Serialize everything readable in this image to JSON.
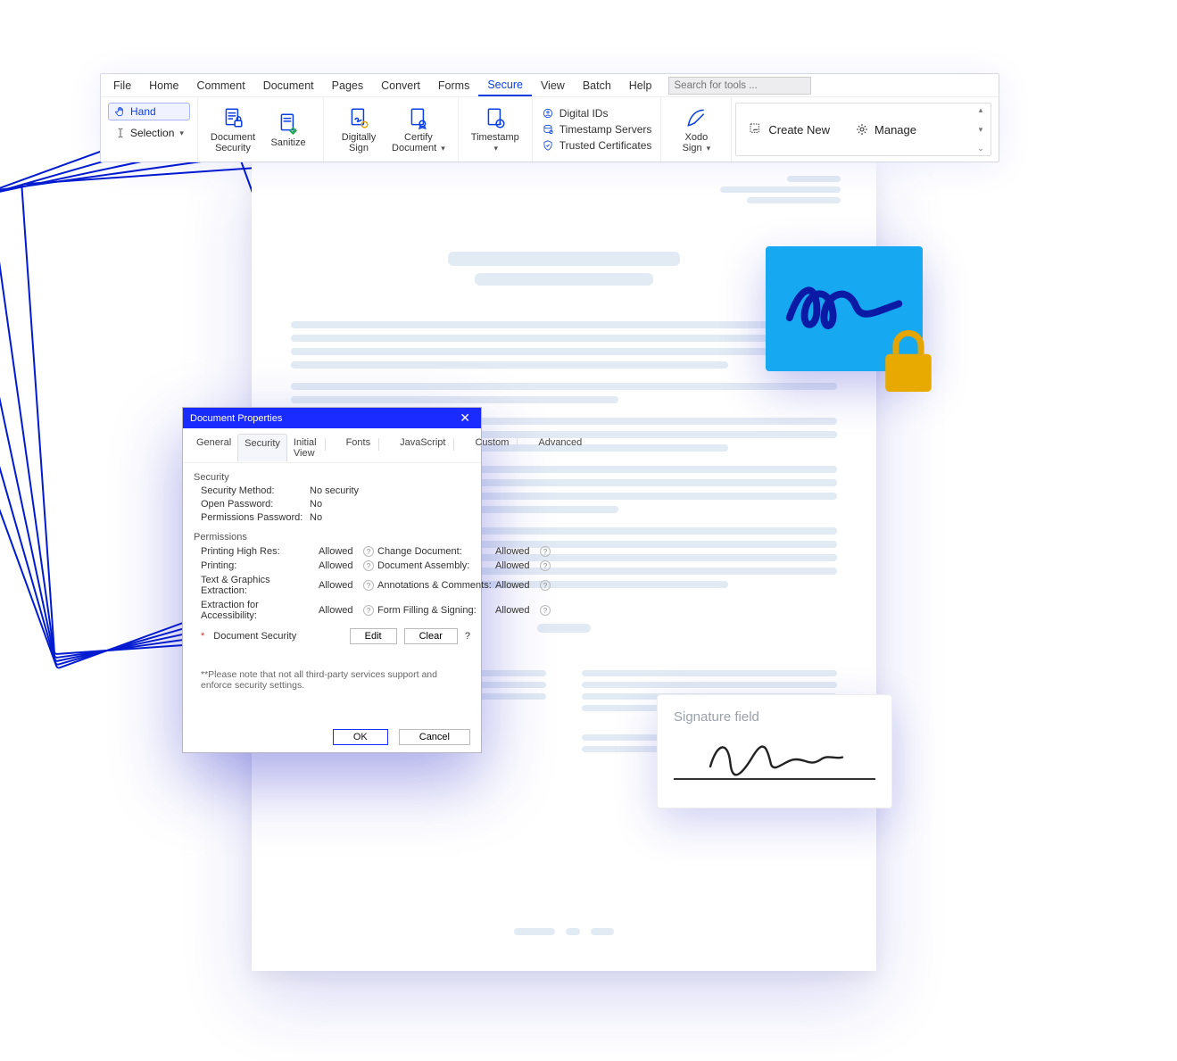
{
  "menu": {
    "items": [
      "File",
      "Home",
      "Comment",
      "Document",
      "Pages",
      "Convert",
      "Forms",
      "Secure",
      "View",
      "Batch",
      "Help"
    ],
    "active": "Secure",
    "search_placeholder": "Search for tools ..."
  },
  "toolbar": {
    "hand": "Hand",
    "selection": "Selection",
    "doc_security": "Document\nSecurity",
    "sanitize": "Sanitize",
    "digitally_sign": "Digitally\nSign",
    "certify": "Certify\nDocument",
    "timestamp": "Timestamp",
    "digital_ids": "Digital IDs",
    "ts_servers": "Timestamp Servers",
    "trusted_certs": "Trusted Certificates",
    "xodo_sign": "Xodo\nSign",
    "create_new": "Create New",
    "manage": "Manage"
  },
  "dialog": {
    "title": "Document Properties",
    "tabs": [
      "General",
      "Security",
      "Initial View",
      "Fonts",
      "JavaScript",
      "Custom",
      "Advanced"
    ],
    "active_tab": "Security",
    "security_section": "Security",
    "sec_method_k": "Security Method:",
    "sec_method_v": "No security",
    "open_pw_k": "Open Password:",
    "open_pw_v": "No",
    "perm_pw_k": "Permissions Password:",
    "perm_pw_v": "No",
    "permissions_section": "Permissions",
    "perm_rows": [
      {
        "l": "Printing High Res:",
        "lv": "Allowed",
        "r": "Change Document:",
        "rv": "Allowed"
      },
      {
        "l": "Printing:",
        "lv": "Allowed",
        "r": "Document Assembly:",
        "rv": "Allowed"
      },
      {
        "l": "Text & Graphics Extraction:",
        "lv": "Allowed",
        "r": "Annotations & Comments:",
        "rv": "Allowed"
      },
      {
        "l": "Extraction for Accessibility:",
        "lv": "Allowed",
        "r": "Form Filling & Signing:",
        "rv": "Allowed"
      }
    ],
    "doc_security_label": "Document Security",
    "edit": "Edit",
    "clear": "Clear",
    "note": "**Please note that not all third-party services support and enforce security settings.",
    "ok": "OK",
    "cancel": "Cancel"
  },
  "signature": {
    "label": "Signature field"
  }
}
